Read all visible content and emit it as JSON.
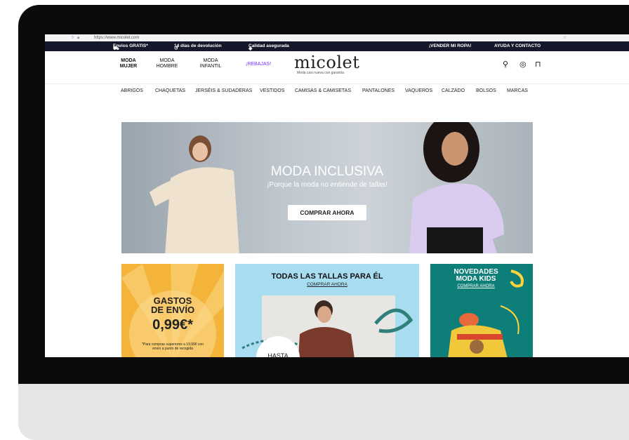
{
  "browser": {
    "url": "https://www.micolet.com"
  },
  "topbar": {
    "shipping": "Envíos GRATIS*",
    "returns": "14 días de devolución",
    "quality": "Calidad asegurada",
    "sell": "¡VENDER MI ROPA!",
    "help": "AYUDA Y CONTACTO"
  },
  "header": {
    "nav": [
      {
        "line1": "MODA",
        "line2": "MUJER"
      },
      {
        "line1": "MODA",
        "line2": "HOMBRE"
      },
      {
        "line1": "MODA",
        "line2": "INFANTIL"
      }
    ],
    "rebajas": "¡REBAJAS!",
    "logo": "micolet",
    "tagline": "Moda casi nueva con garantía"
  },
  "categories": [
    "ABRIGOS",
    "CHAQUETAS",
    "JERSÉIS & SUDADERAS",
    "VESTIDOS",
    "CAMISAS & CAMISETAS",
    "PANTALONES",
    "VAQUEROS",
    "CALZADO",
    "BOLSOS",
    "MARCAS"
  ],
  "hero": {
    "title": "MODA INCLUSIVA",
    "subtitle": "¡Porque la moda no entiende de tallas!",
    "button": "COMPRAR AHORA"
  },
  "cards": {
    "shipping": {
      "title1": "GASTOS",
      "title2": "DE ENVÍO",
      "price": "0,99€*",
      "fine": "*Para compras superiores a 19,99€ con envío a punto de recogida"
    },
    "men": {
      "title": "TODAS LAS TALLAS PARA ÉL",
      "link": "COMPRAR AHORA",
      "badge": "HASTA"
    },
    "kids": {
      "title1": "NOVEDADES",
      "title2": "MODA KIDS",
      "link": "COMPRAR AHORA"
    }
  },
  "colors": {
    "topbar": "#15172a",
    "rebajas": "#7a32ff",
    "accent_green": "#5fd39a",
    "card_yellow": "#f4b43a",
    "card_blue": "#a8dcf0",
    "card_teal": "#0e7e78"
  }
}
